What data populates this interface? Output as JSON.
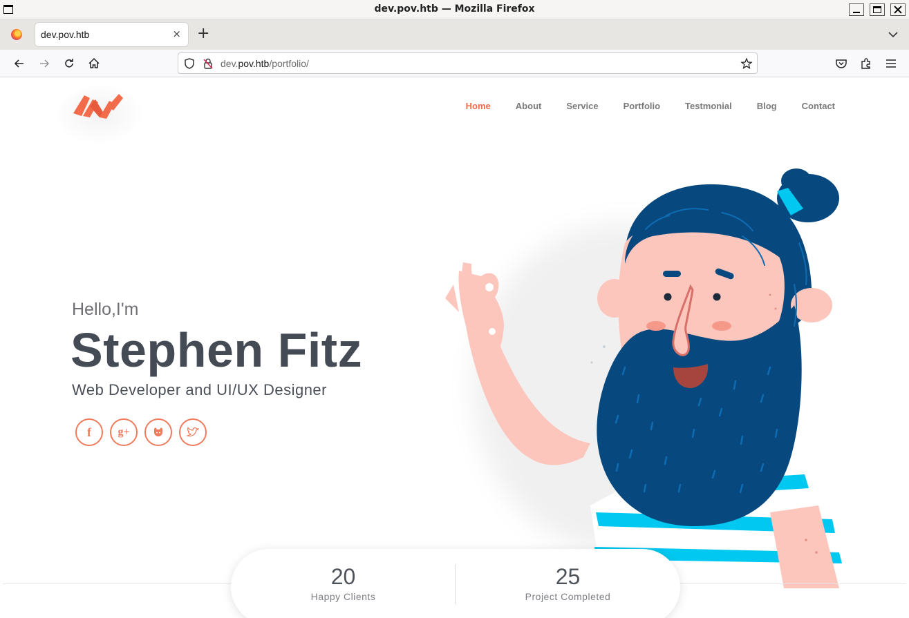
{
  "window": {
    "title": "dev.pov.htb — Mozilla Firefox"
  },
  "browser": {
    "tab_title": "dev.pov.htb",
    "tab_close": "×",
    "new_tab": "+",
    "url_host_prefix": "dev.",
    "url_host": "pov.htb",
    "url_path": "/portfolio/"
  },
  "site": {
    "menu": [
      {
        "label": "Home",
        "active": true
      },
      {
        "label": "About"
      },
      {
        "label": "Service"
      },
      {
        "label": "Portfolio"
      },
      {
        "label": "Testmonial"
      },
      {
        "label": "Blog"
      },
      {
        "label": "Contact"
      }
    ],
    "hero": {
      "greeting": "Hello,I'm",
      "name": "Stephen Fitz",
      "role": "Web Developer and UI/UX Designer",
      "socials": [
        {
          "icon": "facebook-icon",
          "glyph": "f"
        },
        {
          "icon": "google-plus-icon",
          "glyph": "g+"
        },
        {
          "icon": "github-icon",
          "glyph": ""
        },
        {
          "icon": "twitter-icon",
          "glyph": ""
        }
      ]
    },
    "stats": [
      {
        "value": "20",
        "label": "Happy Clients"
      },
      {
        "value": "25",
        "label": "Project Completed"
      }
    ],
    "colors": {
      "accent": "#f26b4a",
      "heading": "#454b54",
      "hair": "#07497f",
      "skin": "#fcc6bd",
      "stripe": "#00c8f0"
    }
  }
}
